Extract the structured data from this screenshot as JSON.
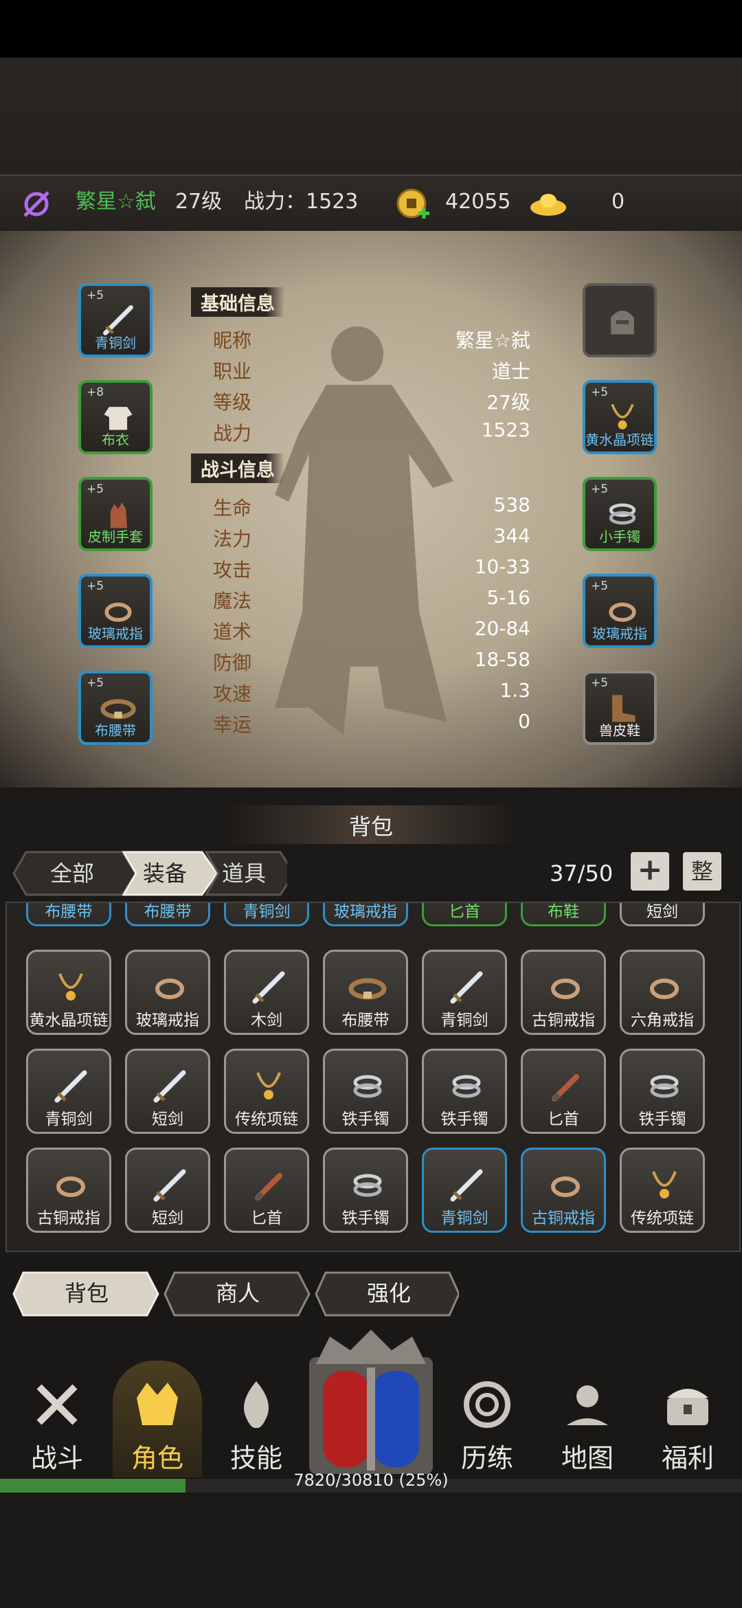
{
  "topbar": {
    "name": "繁星☆弑",
    "level": "27级",
    "power": "战力：1523",
    "coins": "42055",
    "gold": "0"
  },
  "equip_left": [
    {
      "plus": "+5",
      "label": "青铜剑",
      "rarity": "blue",
      "icon": "sword-icon"
    },
    {
      "plus": "+8",
      "label": "布衣",
      "rarity": "green",
      "icon": "cloth-armor-icon"
    },
    {
      "plus": "+5",
      "label": "皮制手套",
      "rarity": "green",
      "icon": "glove-icon"
    },
    {
      "plus": "+5",
      "label": "玻璃戒指",
      "rarity": "blue",
      "icon": "ring-icon"
    },
    {
      "plus": "+5",
      "label": "布腰带",
      "rarity": "blue",
      "icon": "belt-icon"
    }
  ],
  "equip_right": [
    {
      "plus": "",
      "label": "",
      "rarity": "empty",
      "icon": "helmet-icon"
    },
    {
      "plus": "+5",
      "label": "黄水晶项链",
      "rarity": "blue",
      "icon": "necklace-icon"
    },
    {
      "plus": "+5",
      "label": "小手镯",
      "rarity": "green",
      "icon": "bracelet-icon"
    },
    {
      "plus": "+5",
      "label": "玻璃戒指",
      "rarity": "blue",
      "icon": "ring-icon"
    },
    {
      "plus": "+5",
      "label": "兽皮鞋",
      "rarity": "grey",
      "icon": "boots-icon"
    }
  ],
  "basic_title": "基础信息",
  "basic": [
    {
      "label": "昵称",
      "value": "繁星☆弑"
    },
    {
      "label": "职业",
      "value": "道士"
    },
    {
      "label": "等级",
      "value": "27级"
    },
    {
      "label": "战力",
      "value": "1523"
    }
  ],
  "combat_title": "战斗信息",
  "combat": [
    {
      "label": "生命",
      "value": "538"
    },
    {
      "label": "法力",
      "value": "344"
    },
    {
      "label": "攻击",
      "value": "10-33"
    },
    {
      "label": "魔法",
      "value": "5-16"
    },
    {
      "label": "道术",
      "value": "20-84"
    },
    {
      "label": "防御",
      "value": "18-58"
    },
    {
      "label": "攻速",
      "value": "1.3"
    },
    {
      "label": "幸运",
      "value": "0"
    }
  ],
  "bag": {
    "title": "背包",
    "tabs": [
      "全部",
      "装备",
      "道具"
    ],
    "selected_tab": "装备",
    "count": "37/50",
    "sort_label": "整",
    "add_label": "+",
    "partial_row": [
      {
        "label": "布腰带",
        "rarity": "blue"
      },
      {
        "label": "布腰带",
        "rarity": "blue"
      },
      {
        "label": "青铜剑",
        "rarity": "blue"
      },
      {
        "label": "玻璃戒指",
        "rarity": "blue"
      },
      {
        "label": "匕首",
        "rarity": "green"
      },
      {
        "label": "布鞋",
        "rarity": "green"
      },
      {
        "label": "短剑",
        "rarity": "grey"
      }
    ],
    "rows": [
      [
        {
          "label": "黄水晶项链",
          "rarity": "grey",
          "icon": "necklace-icon"
        },
        {
          "label": "玻璃戒指",
          "rarity": "grey",
          "icon": "ring-icon"
        },
        {
          "label": "木剑",
          "rarity": "grey",
          "icon": "sword-icon"
        },
        {
          "label": "布腰带",
          "rarity": "grey",
          "icon": "belt-icon"
        },
        {
          "label": "青铜剑",
          "rarity": "grey",
          "icon": "sword-icon"
        },
        {
          "label": "古铜戒指",
          "rarity": "grey",
          "icon": "ring-icon"
        },
        {
          "label": "六角戒指",
          "rarity": "grey",
          "icon": "ring-icon"
        }
      ],
      [
        {
          "label": "青铜剑",
          "rarity": "grey",
          "icon": "sword-icon"
        },
        {
          "label": "短剑",
          "rarity": "grey",
          "icon": "sword-icon"
        },
        {
          "label": "传统项链",
          "rarity": "grey",
          "icon": "necklace-icon"
        },
        {
          "label": "铁手镯",
          "rarity": "grey",
          "icon": "bracelet-icon"
        },
        {
          "label": "铁手镯",
          "rarity": "grey",
          "icon": "bracelet-icon"
        },
        {
          "label": "匕首",
          "rarity": "grey",
          "icon": "dagger-icon"
        },
        {
          "label": "铁手镯",
          "rarity": "grey",
          "icon": "bracelet-icon"
        }
      ],
      [
        {
          "label": "古铜戒指",
          "rarity": "grey",
          "icon": "ring-icon"
        },
        {
          "label": "短剑",
          "rarity": "grey",
          "icon": "sword-icon"
        },
        {
          "label": "匕首",
          "rarity": "grey",
          "icon": "dagger-icon"
        },
        {
          "label": "铁手镯",
          "rarity": "grey",
          "icon": "bracelet-icon"
        },
        {
          "label": "青铜剑",
          "rarity": "blue",
          "icon": "sword-icon"
        },
        {
          "label": "古铜戒指",
          "rarity": "blue",
          "icon": "ring-icon"
        },
        {
          "label": "传统项链",
          "rarity": "grey",
          "icon": "necklace-icon"
        }
      ]
    ]
  },
  "bottom_tabs": [
    "背包",
    "商人",
    "强化"
  ],
  "nav": [
    {
      "label": "战斗",
      "icon": "crossed-swords-icon"
    },
    {
      "label": "角色",
      "icon": "crown-mask-icon",
      "selected": true
    },
    {
      "label": "技能",
      "icon": "flame-icon"
    },
    {
      "label": "历练",
      "icon": "spiral-icon"
    },
    {
      "label": "地图",
      "icon": "map-pin-icon"
    },
    {
      "label": "福利",
      "icon": "treasure-chest-icon"
    }
  ],
  "xp": {
    "text": "7820/30810 (25%)",
    "fraction": 0.25
  },
  "colors": {
    "blue": "#2f8fc7",
    "green": "#3e9c3a",
    "gold": "#f6cc4a"
  }
}
